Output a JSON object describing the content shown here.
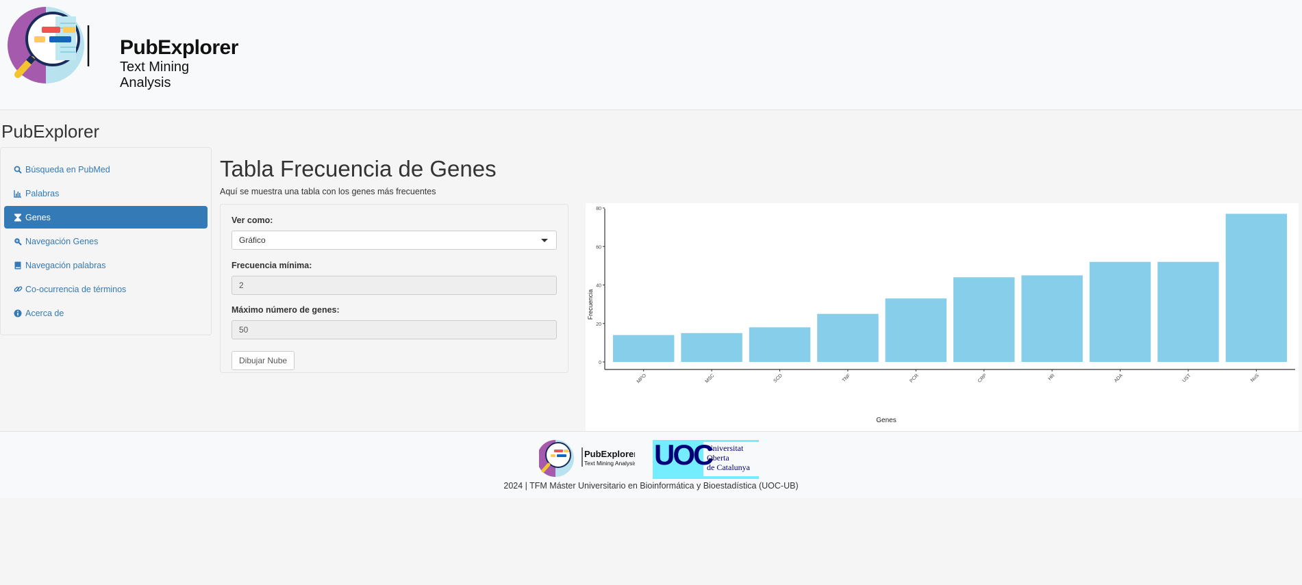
{
  "brand": {
    "title": "PubExplorer",
    "subtitle": "Text Mining Analysis"
  },
  "app_title": "PubExplorer",
  "sidebar": {
    "items": [
      {
        "label": "Búsqueda en PubMed",
        "icon": "search-icon",
        "active": false
      },
      {
        "label": "Palabras",
        "icon": "bar-chart-icon",
        "active": false
      },
      {
        "label": "Genes",
        "icon": "hourglass-icon",
        "active": true
      },
      {
        "label": "Navegación Genes",
        "icon": "search-plus-icon",
        "active": false
      },
      {
        "label": "Navegación palabras",
        "icon": "book-icon",
        "active": false
      },
      {
        "label": "Co-ocurrencia de términos",
        "icon": "link-icon",
        "active": false
      },
      {
        "label": "Acerca de",
        "icon": "info-circle-icon",
        "active": false
      }
    ]
  },
  "main": {
    "title": "Tabla Frecuencia de Genes",
    "description": "Aquí se muestra una tabla con los genes más frecuentes"
  },
  "form": {
    "view_label": "Ver como:",
    "view_value": "Gráfico",
    "min_freq_label": "Frecuencia mínima:",
    "min_freq_value": "2",
    "max_genes_label": "Máximo número de genes:",
    "max_genes_value": "50",
    "draw_button": "Dibujar Nube"
  },
  "chart_data": {
    "type": "bar",
    "categories": [
      "MPO",
      "MSC",
      "SCD",
      "TNF",
      "PCR",
      "CRP",
      "HR",
      "ADA",
      "UST",
      "NoS"
    ],
    "values": [
      14,
      15,
      18,
      25,
      33,
      44,
      45,
      52,
      52,
      77
    ],
    "xlabel": "Genes",
    "ylabel": "Frecuencia",
    "ylim": [
      0,
      80
    ],
    "yticks": [
      0,
      20,
      40,
      60,
      80
    ],
    "bar_color": "#87CEEB",
    "grid": false
  },
  "footer": {
    "pub_title": "PubExplorer",
    "pub_sub": "Text Mining Analysis",
    "uoc_logo_text": "UOC",
    "uoc_name_1": "Universitat",
    "uoc_name_2": "Oberta",
    "uoc_name_3": "de Catalunya",
    "text": "2024 | TFM Máster Universitario en Bioinformática y Bioestadística (UOC-UB)"
  },
  "colors": {
    "accent": "#337ab7",
    "bar": "#87CEEB",
    "uoc_blue": "#000078",
    "uoc_cyan": "#73EDFF"
  }
}
